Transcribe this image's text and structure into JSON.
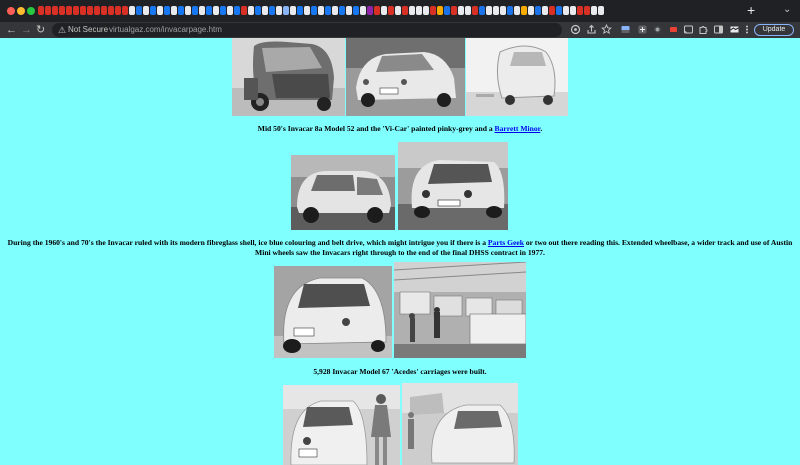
{
  "browser": {
    "tab_colors": [
      "#d93025",
      "#d93025",
      "#d93025",
      "#d93025",
      "#d93025",
      "#d93025",
      "#d93025",
      "#d93025",
      "#d93025",
      "#d93025",
      "#d93025",
      "#d93025",
      "#d93025",
      "#e8eaed",
      "#1a73e8",
      "#e8eaed",
      "#1877f2",
      "#e8eaed",
      "#1877f2",
      "#e8eaed",
      "#1877f2",
      "#e8eaed",
      "#1877f2",
      "#e8eaed",
      "#1877f2",
      "#e8eaed",
      "#1877f2",
      "#e8eaed",
      "#1877f2",
      "#d93025",
      "#e8eaed",
      "#1877f2",
      "#e8eaed",
      "#1877f2",
      "#e8eaed",
      "#8ab4f8",
      "#e8eaed",
      "#1877f2",
      "#e8eaed",
      "#1877f2",
      "#e8eaed",
      "#1877f2",
      "#e8eaed",
      "#1877f2",
      "#e8eaed",
      "#1877f2",
      "#e8eaed",
      "#8e24aa",
      "#d93025",
      "#e8eaed",
      "#d93025",
      "#e8eaed",
      "#d93025",
      "#e8eaed",
      "#e8eaed",
      "#e8eaed",
      "#d93025",
      "#f9ab00",
      "#1a73e8",
      "#d93025",
      "#e8eaed",
      "#e8eaed",
      "#d93025",
      "#1a73e8",
      "#e8eaed",
      "#e8eaed",
      "#e8eaed",
      "#1a73e8",
      "#e8eaed",
      "#f9ab00",
      "#e8eaed",
      "#1a73e8",
      "#e8eaed",
      "#d93025",
      "#1a73e8",
      "#e8eaed",
      "#e8eaed",
      "#d93025",
      "#d93025",
      "#e8eaed",
      "#e8eaed"
    ],
    "new_tab_glyph": "+",
    "tab_search_glyph": "⌄",
    "back_glyph": "←",
    "forward_glyph": "→",
    "reload_glyph": "↻",
    "warning_glyph": "⚠",
    "not_secure_label": "Not Secure",
    "url": "virtualgaz.com/invacarpage.htm",
    "update_label": "Update",
    "toolbar_icons": [
      "google-lens-icon",
      "share-icon",
      "bookmark-star-icon",
      "extension-puzzle-icon",
      "extension-icon",
      "extension-icon",
      "cast-icon",
      "extension-icon",
      "sidebar-icon",
      "profile-icon"
    ]
  },
  "page": {
    "background": "#80ffff",
    "captions": {
      "first": {
        "before": "Mid 50's Invacar 8a Model 52 and the 'Vi-Car' painted pinky-grey and a ",
        "link": "Barrett Minor",
        "after": "."
      },
      "second": {
        "before": "During the 1960's and 70's the Invacar ruled with its modern fibreglass shell, ice blue colouring and belt drive, which might intrigue you if there is a ",
        "link": "Parts Geek",
        "after": " or two out there reading this. Extended wheelbase, a wider track and use of Austin Mini wheels saw the Invacars right through to the end of the final DHSS contract in 1977."
      },
      "third": "5,928 Invacar Model 67 'Acedes' carriages were built."
    },
    "photos": {
      "row1": [
        "photo-invacar-model-52",
        "photo-vi-car",
        "photo-barrett-minor"
      ],
      "row2": [
        "photo-invacar-side",
        "photo-invacar-front"
      ],
      "row3": [
        "photo-invacar-model-67",
        "photo-factory-line"
      ],
      "row4": [
        "photo-invacar-with-woman",
        "photo-invacar-rear"
      ]
    }
  }
}
